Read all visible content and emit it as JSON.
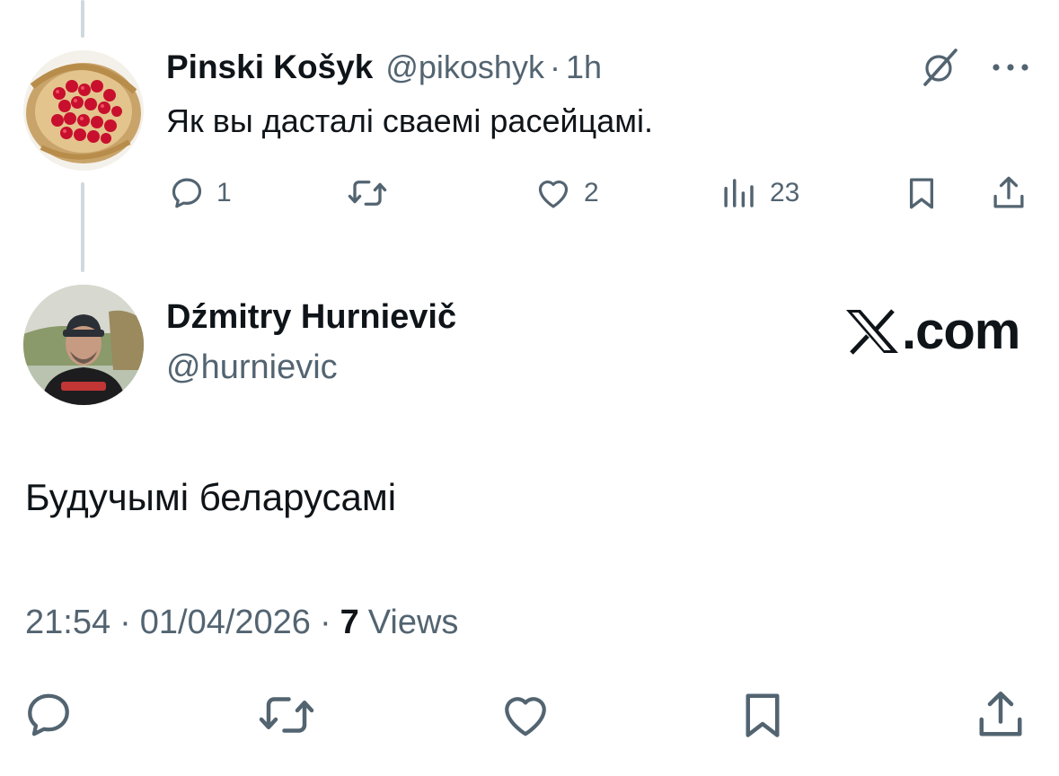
{
  "parent_tweet": {
    "author_name": "Pinski Košyk",
    "handle": "@pikoshyk",
    "separator": "·",
    "time": "1h",
    "text": "Як вы дасталі сваемі расейцамі.",
    "counts": {
      "replies": "1",
      "likes": "2",
      "views": "23"
    },
    "icons": [
      "grok-icon",
      "more-icon",
      "reply-icon",
      "retweet-icon",
      "like-icon",
      "views-icon",
      "bookmark-icon",
      "share-icon"
    ]
  },
  "main_tweet": {
    "author_name": "Dźmitry Hurnievič",
    "handle": "@hurnievic",
    "brand": ".com",
    "text": "Будучымі беларусамі",
    "time": "21:54",
    "date": "01/04/2026",
    "separator": "·",
    "views_count": "7",
    "views_label": "Views",
    "icons": [
      "reply-icon",
      "retweet-icon",
      "like-icon",
      "bookmark-icon",
      "share-icon"
    ]
  },
  "colors": {
    "text": "#0f1419",
    "secondary": "#536471",
    "thread_line": "#cfd9de"
  }
}
